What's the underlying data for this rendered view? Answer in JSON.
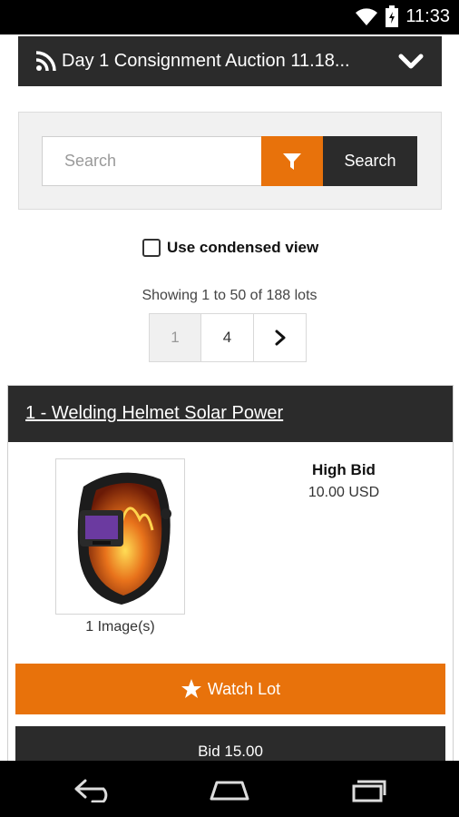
{
  "status_bar": {
    "time": "11:33"
  },
  "header": {
    "title": "Day 1 Consignment Auction 11.18..."
  },
  "search": {
    "placeholder": "Search",
    "button_label": "Search"
  },
  "condensed": {
    "label": "Use condensed view",
    "checked": false
  },
  "results": {
    "showing_text": "Showing 1 to 50 of 188 lots"
  },
  "pager": {
    "pages": [
      "1",
      "4"
    ],
    "current": "1"
  },
  "lot": {
    "title": "1 - Welding Helmet Solar Power",
    "image_count": "1 Image(s)",
    "bid_label": "High Bid",
    "bid_value": "10.00 USD",
    "watch_label": "Watch Lot",
    "bid_button": "Bid 15.00"
  },
  "colors": {
    "accent": "#e8720b",
    "dark": "#2b2b2b"
  },
  "icons": [
    "wifi-icon",
    "battery-icon",
    "rss-icon",
    "chevron-down-icon",
    "filter-icon",
    "chevron-right-icon",
    "star-icon",
    "back-icon",
    "home-icon",
    "recent-apps-icon"
  ]
}
